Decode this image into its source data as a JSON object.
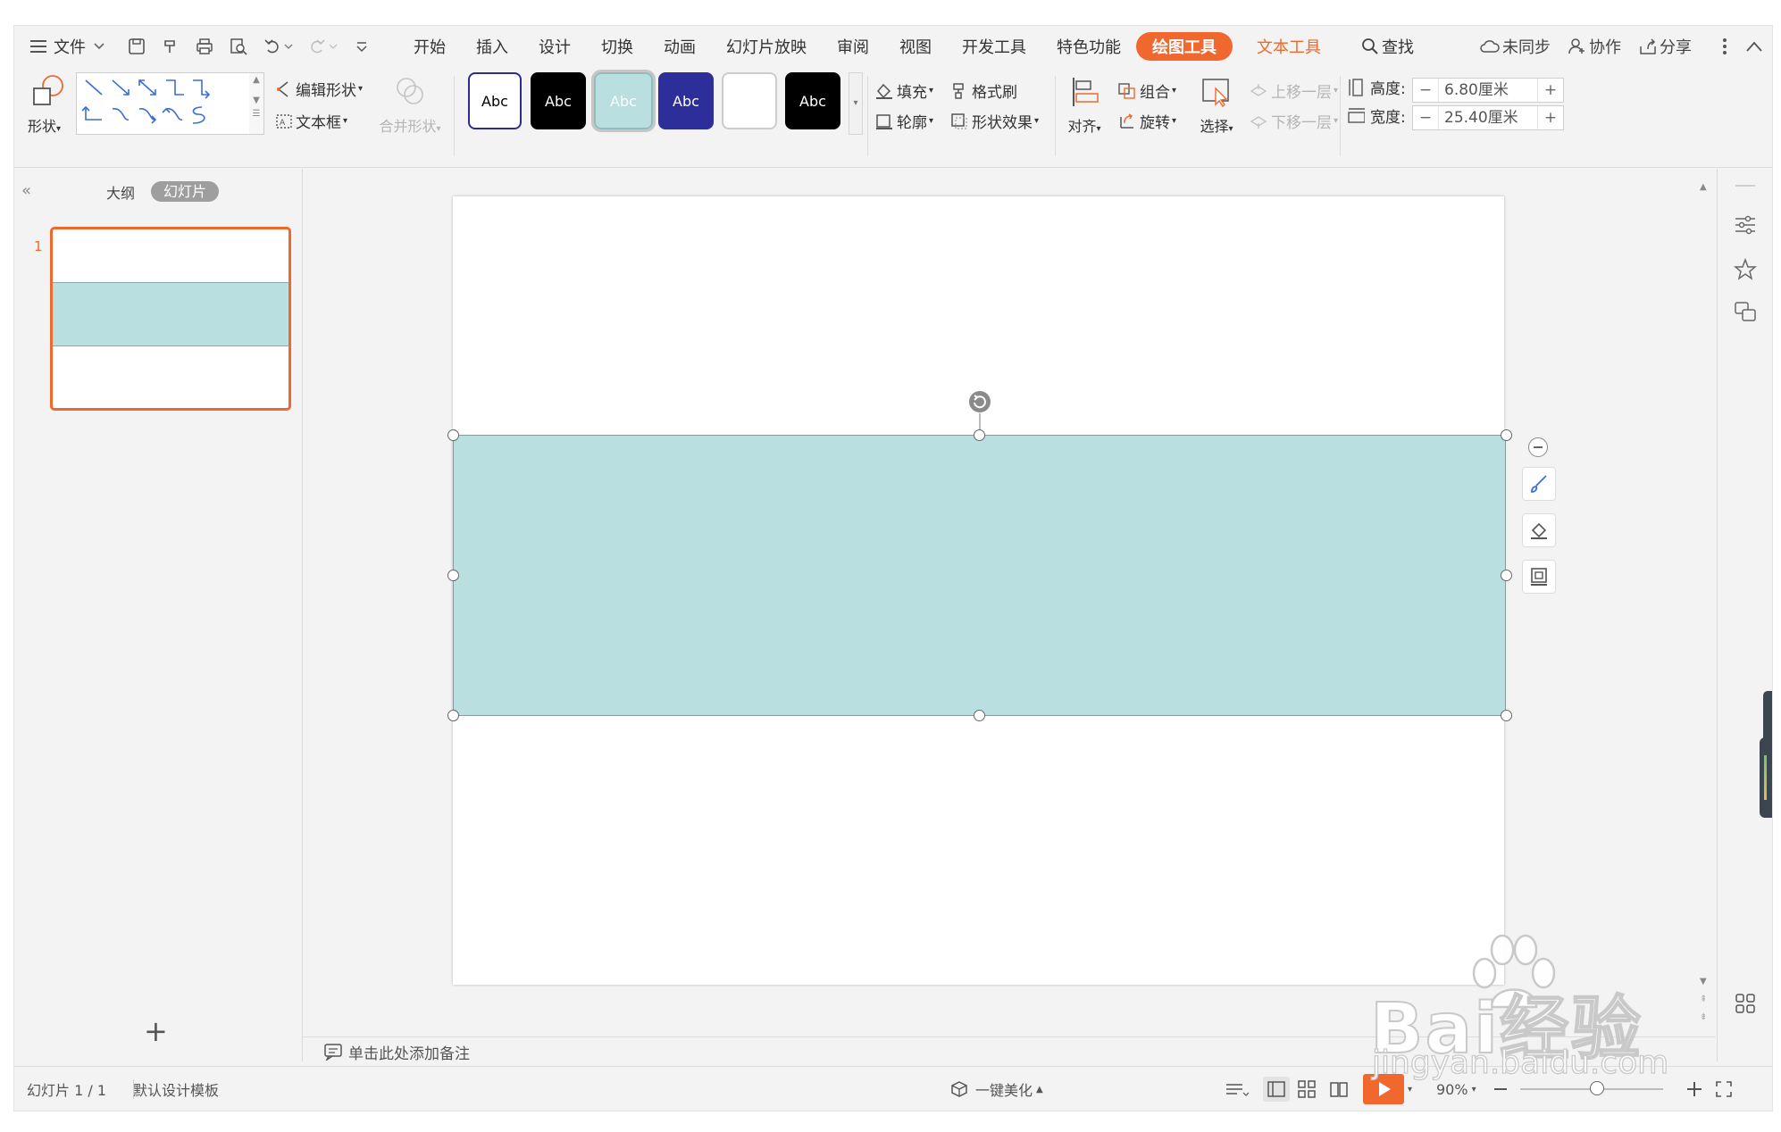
{
  "menubar": {
    "file_label": "文件",
    "tabs": [
      "开始",
      "插入",
      "设计",
      "切换",
      "动画",
      "幻灯片放映",
      "审阅",
      "视图",
      "开发工具",
      "特色功能"
    ],
    "active_tab": "绘图工具",
    "text_tool_tab": "文本工具",
    "search_label": "查找",
    "sync_label": "未同步",
    "collab_label": "协作",
    "share_label": "分享"
  },
  "ribbon": {
    "shape_label": "形状",
    "edit_shape_label": "编辑形状",
    "textbox_label": "文本框",
    "merge_shape_label": "合并形状",
    "style_presets": [
      {
        "text": "Abc",
        "bg": "#ffffff",
        "fg": "#000000",
        "border": "#2d2d8c"
      },
      {
        "text": "Abc",
        "bg": "#000000",
        "fg": "#ffffff",
        "border": "#000000"
      },
      {
        "text": "Abc",
        "bg": "#b9dfe1",
        "fg": "#ffffff",
        "border": "#8fbcbf"
      },
      {
        "text": "Abc",
        "bg": "#2e2e9a",
        "fg": "#ffffff",
        "border": "#2e2e9a"
      },
      {
        "text": "",
        "bg": "#ffffff",
        "fg": "#000000",
        "border": "#cccccc"
      },
      {
        "text": "Abc",
        "bg": "#000000",
        "fg": "#ffffff",
        "border": "#000000"
      }
    ],
    "fill_label": "填充",
    "format_painter_label": "格式刷",
    "outline_label": "轮廓",
    "shape_effect_label": "形状效果",
    "align_label": "对齐",
    "group_label": "组合",
    "rotate_label": "旋转",
    "select_label": "选择",
    "bring_forward_label": "上移一层",
    "send_backward_label": "下移一层",
    "height_label": "高度:",
    "height_value": "6.80厘米",
    "width_label": "宽度:",
    "width_value": "25.40厘米"
  },
  "left_panel": {
    "outline_tab": "大纲",
    "slides_tab": "幻灯片",
    "slide_number": "1",
    "add_label": "+"
  },
  "notes": {
    "placeholder": "单击此处添加备注"
  },
  "statusbar": {
    "slide_info": "幻灯片 1 / 1",
    "template": "默认设计模板",
    "beautify": "一键美化",
    "zoom": "90%"
  },
  "watermark": {
    "brand": "Bai经验",
    "url": "jingyan.baidu.com"
  },
  "colors": {
    "accent": "#f0682e",
    "shape_fill": "#b9dfe1"
  }
}
